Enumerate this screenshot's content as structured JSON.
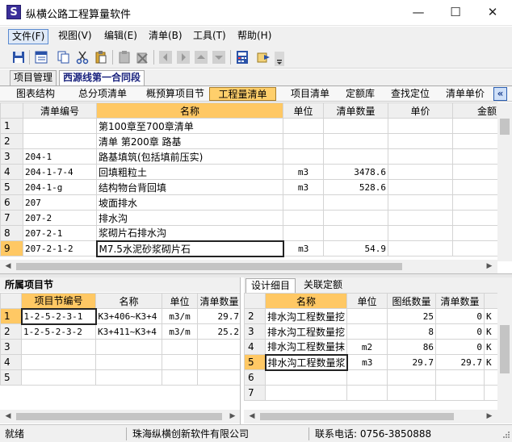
{
  "window": {
    "title": "纵横公路工程算量软件",
    "icon_letter": "S",
    "minimize": "—",
    "maximize": "☐",
    "close": "✕"
  },
  "menu": [
    "文件(F)",
    "视图(V)",
    "编辑(E)",
    "清单(B)",
    "工具(T)",
    "帮助(H)"
  ],
  "toolbar_icons": [
    "save-icon",
    "list-icon",
    "copy-icon",
    "cut-icon",
    "paste-icon",
    "clipboard-icon",
    "delete-icon",
    "nav-left-icon",
    "nav-right-icon",
    "nav-up-icon",
    "nav-down-icon",
    "calc-icon",
    "export-icon",
    "more-icon"
  ],
  "tabs": [
    "项目管理",
    "西源线第一合同段"
  ],
  "subnav": [
    "图表结构",
    "总分项清单",
    "概预算项目节",
    "工程量清单",
    "项目清单",
    "定额库",
    "查找定位",
    "清单单价"
  ],
  "subnav_collapse": "«",
  "main_table": {
    "headers": [
      "",
      "清单编号",
      "名称",
      "单位",
      "清单数量",
      "单价",
      "金额"
    ],
    "rows": [
      [
        "1",
        "",
        "第100章至700章清单",
        "",
        "",
        "",
        ""
      ],
      [
        "2",
        "",
        "清单 第200章  路基",
        "",
        "",
        "",
        ""
      ],
      [
        "3",
        "204-1",
        "路基填筑(包括填前压实)",
        "",
        "",
        "",
        ""
      ],
      [
        "4",
        "204-1-7-4",
        "回填粗粒土",
        "m3",
        "3478.6",
        "",
        ""
      ],
      [
        "5",
        "204-1-g",
        "结构物台背回填",
        "m3",
        "528.6",
        "",
        ""
      ],
      [
        "6",
        "207",
        "坡面排水",
        "",
        "",
        "",
        ""
      ],
      [
        "7",
        "207-2",
        "排水沟",
        "",
        "",
        "",
        ""
      ],
      [
        "8",
        "207-2-1",
        "浆砌片石排水沟",
        "",
        "",
        "",
        ""
      ],
      [
        "9",
        "207-2-1-2",
        "M7.5水泥砂浆砌片石",
        "m3",
        "54.9",
        "",
        ""
      ]
    ]
  },
  "left_panel": {
    "title": "所属项目节",
    "headers": [
      "",
      "项目节编号",
      "名称",
      "单位",
      "清单数量"
    ],
    "rows": [
      [
        "1",
        "1-2-5-2-3-1",
        "K3+406~K3+4",
        "m3/m",
        "29.7"
      ],
      [
        "2",
        "1-2-5-2-3-2",
        "K3+411~K3+4",
        "m3/m",
        "25.2"
      ],
      [
        "3",
        "",
        "",
        "",
        ""
      ],
      [
        "4",
        "",
        "",
        "",
        ""
      ],
      [
        "5",
        "",
        "",
        "",
        ""
      ]
    ]
  },
  "right_panel": {
    "tabs": [
      "设计细目",
      "关联定额"
    ],
    "headers": [
      "",
      "名称",
      "单位",
      "图纸数量",
      "清单数量",
      ""
    ],
    "rows": [
      [
        "2",
        "排水沟工程数量挖",
        "",
        "25",
        "0",
        "K"
      ],
      [
        "3",
        "排水沟工程数量挖",
        "",
        "8",
        "0",
        "K"
      ],
      [
        "4",
        "排水沟工程数量抹",
        "m2",
        "86",
        "0",
        "K"
      ],
      [
        "5",
        "排水沟工程数量浆",
        "m3",
        "29.7",
        "29.7",
        "K"
      ],
      [
        "6",
        "",
        "",
        "",
        "",
        ""
      ],
      [
        "7",
        "",
        "",
        "",
        "",
        ""
      ]
    ]
  },
  "status": {
    "ready": "就绪",
    "company": "珠海纵横创新软件有限公司",
    "phone": "联系电话: 0756-3850888"
  },
  "colors": {
    "selected_header": "#ffc864",
    "active_subnav": "#ffcf6b",
    "app_icon": "#3b2f9a"
  }
}
